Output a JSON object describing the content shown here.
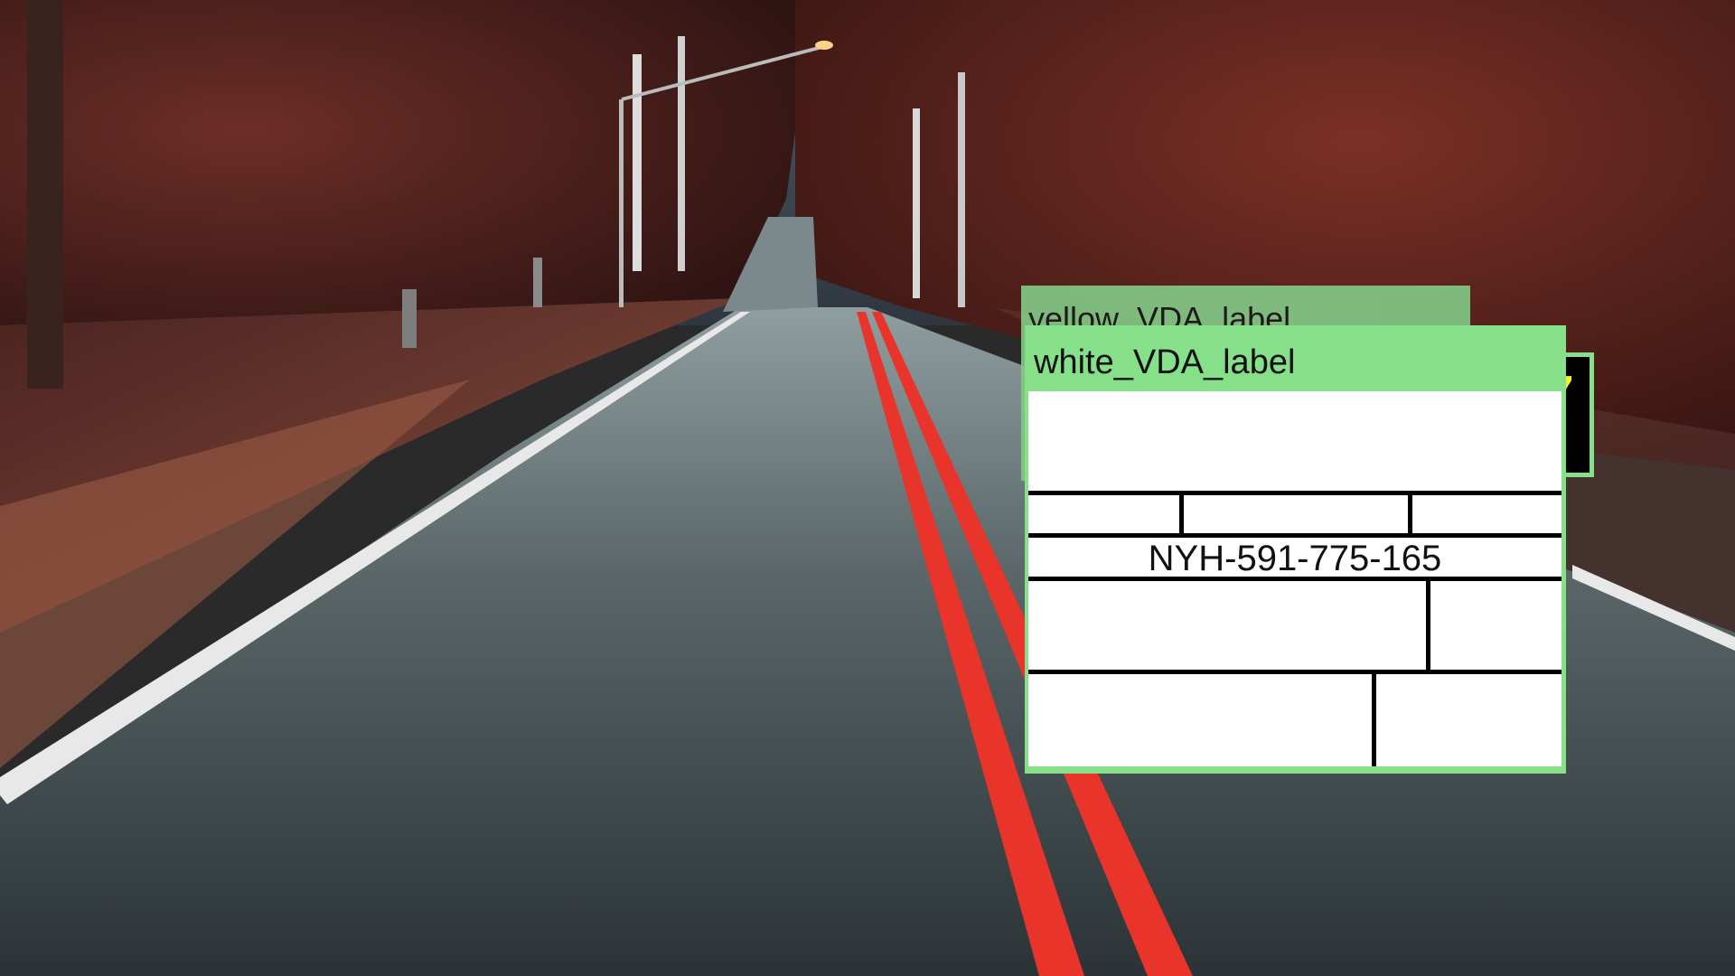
{
  "overlay": {
    "yellow_label": {
      "title": "yellow_VDA_label",
      "text": "7"
    },
    "white_label": {
      "title": "white_VDA_label",
      "code": "NYH-591-775-165"
    }
  },
  "colors": {
    "label_frame": "#86e08a",
    "yellow_text": "#f4f32a",
    "road_center_line": "#e8342a"
  }
}
